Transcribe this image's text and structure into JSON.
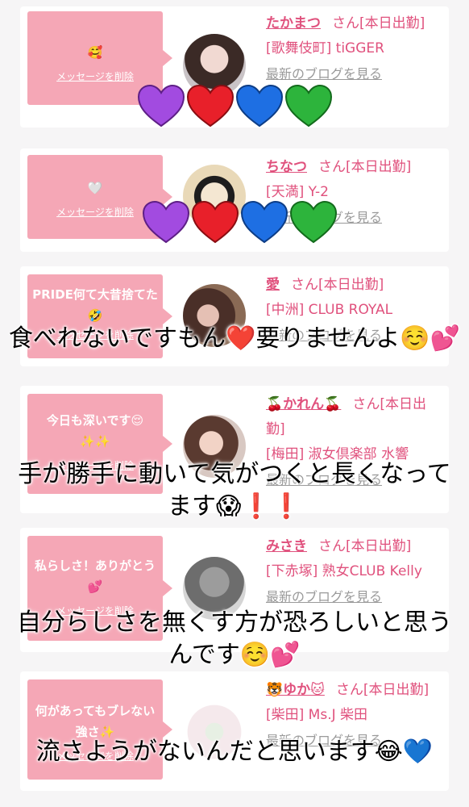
{
  "cards": [
    {
      "message": "🥰",
      "delete_label": "メッセージを削除",
      "name": "たかまつ",
      "status": "さん[本日出勤]",
      "area_shop": "[歌舞伎町] tiGGER",
      "blog_label": "最新のブログを見る"
    },
    {
      "message": "🤍",
      "delete_label": "メッセージを削除",
      "name": "ちなつ",
      "status": "さん[本日出勤]",
      "area_shop": "[天満] Y-2",
      "blog_label": "最新のブログを見る"
    },
    {
      "message": "PRIDE何て大昔捨てた🤣",
      "delete_label": "メッセージを削除",
      "name": "愛",
      "status": "さん[本日出勤]",
      "area_shop": "[中洲] CLUB ROYAL",
      "blog_label": "最新のブログを見る"
    },
    {
      "message": "今日も深いです😌✨✨",
      "delete_label": "メッセージを削除",
      "name": "🍒かれん🍒",
      "status": "さん[本日出勤]",
      "area_shop": "[梅田] 淑女倶楽部 水響",
      "blog_label": "最新のブログを見る"
    },
    {
      "message": "私らしさ！ありがとう💕",
      "delete_label": "メッセージを削除",
      "name": "みさき",
      "status": "さん[本日出勤]",
      "area_shop": "[下赤塚] 熟女CLUB Kelly",
      "blog_label": "最新のブログを見る"
    },
    {
      "message": "何があってもブレない強さ✨",
      "delete_label": "メッセージを削除",
      "name": "🐯ゆか🐱",
      "status": "さん[本日出勤]",
      "area_shop": "[柴田] Ms.J 柴田",
      "blog_label": "最新のブログを見る"
    }
  ],
  "captions": {
    "c1": "食べれないですもん❤️要りませんよ☺️💕",
    "c2": "手が勝手に動いて気がつくと長くなってます😱❗❗",
    "c3": "自分らしさを無くす方が恐ろしいと思うんです☺️💕",
    "c4": "流さようがないんだと思います😂💙"
  },
  "colors": {
    "accent": "#e0517d",
    "bubble": "#f5a7b6",
    "hearts": [
      "#a24be0",
      "#e8202a",
      "#1e6fe3",
      "#2db43c"
    ]
  }
}
